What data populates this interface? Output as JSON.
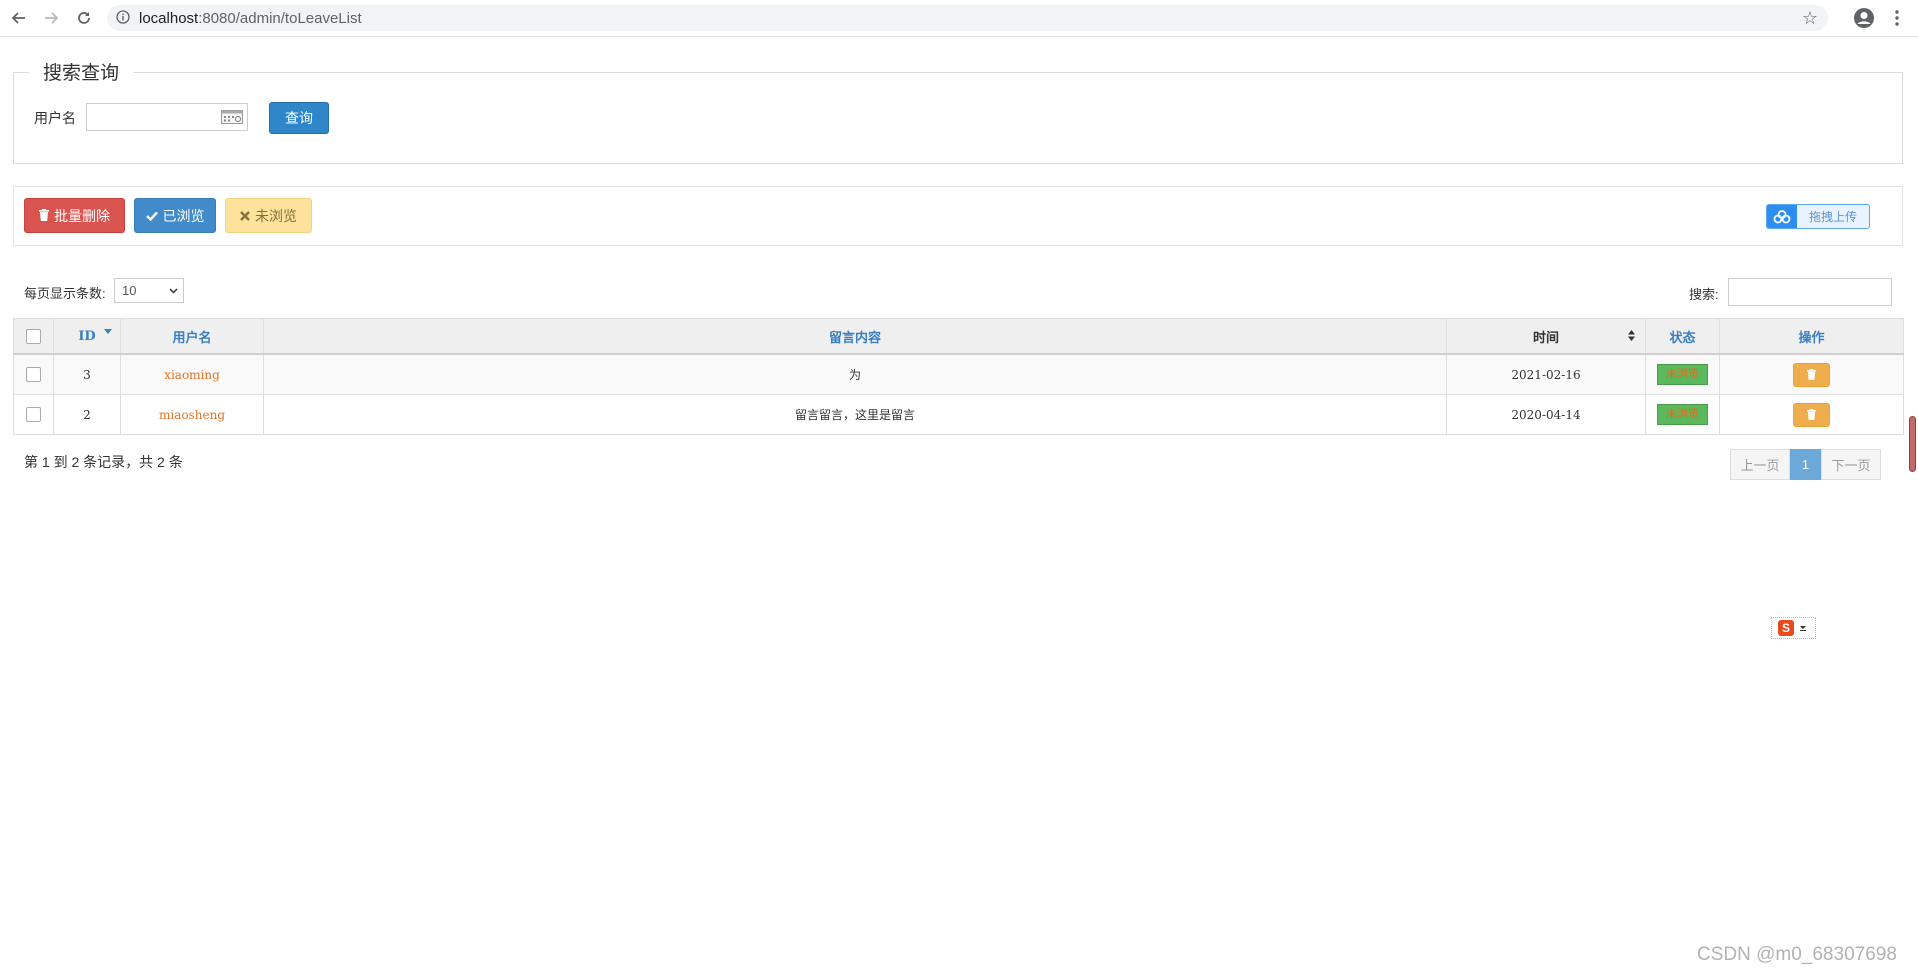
{
  "browser": {
    "url_host": "localhost",
    "url_path": ":8080/admin/toLeaveList"
  },
  "search": {
    "legend": "搜索查询",
    "username_label": "用户名",
    "username_value": "",
    "query_button": "查询"
  },
  "toolbar": {
    "batch_delete": "批量删除",
    "mark_read": "已浏览",
    "mark_unread": "未浏览",
    "upload": "拖拽上传"
  },
  "table_controls": {
    "per_page_label": "每页显示条数:",
    "per_page_value": "10",
    "search_label": "搜索:",
    "search_value": ""
  },
  "table": {
    "headers": [
      "ID",
      "用户名",
      "留言内容",
      "时间",
      "状态",
      "操作"
    ],
    "rows": [
      {
        "id": "3",
        "username": "xiaoming",
        "content": "为",
        "time": "2021-02-16",
        "status": "未浏览"
      },
      {
        "id": "2",
        "username": "miaosheng",
        "content": "留言留言，这里是留言",
        "time": "2020-04-14",
        "status": "未浏览"
      }
    ]
  },
  "footer": {
    "records": "第 1 到 2 条记录，共 2 条"
  },
  "pagination": {
    "prev": "上一页",
    "current": "1",
    "next": "下一页"
  },
  "watermark": "CSDN @m0_68307698",
  "colors": {
    "primary": "#2f86c8",
    "danger": "#d9534f",
    "info": "#428bca",
    "warning": "#f0ad4e",
    "success": "#5cb85c"
  }
}
